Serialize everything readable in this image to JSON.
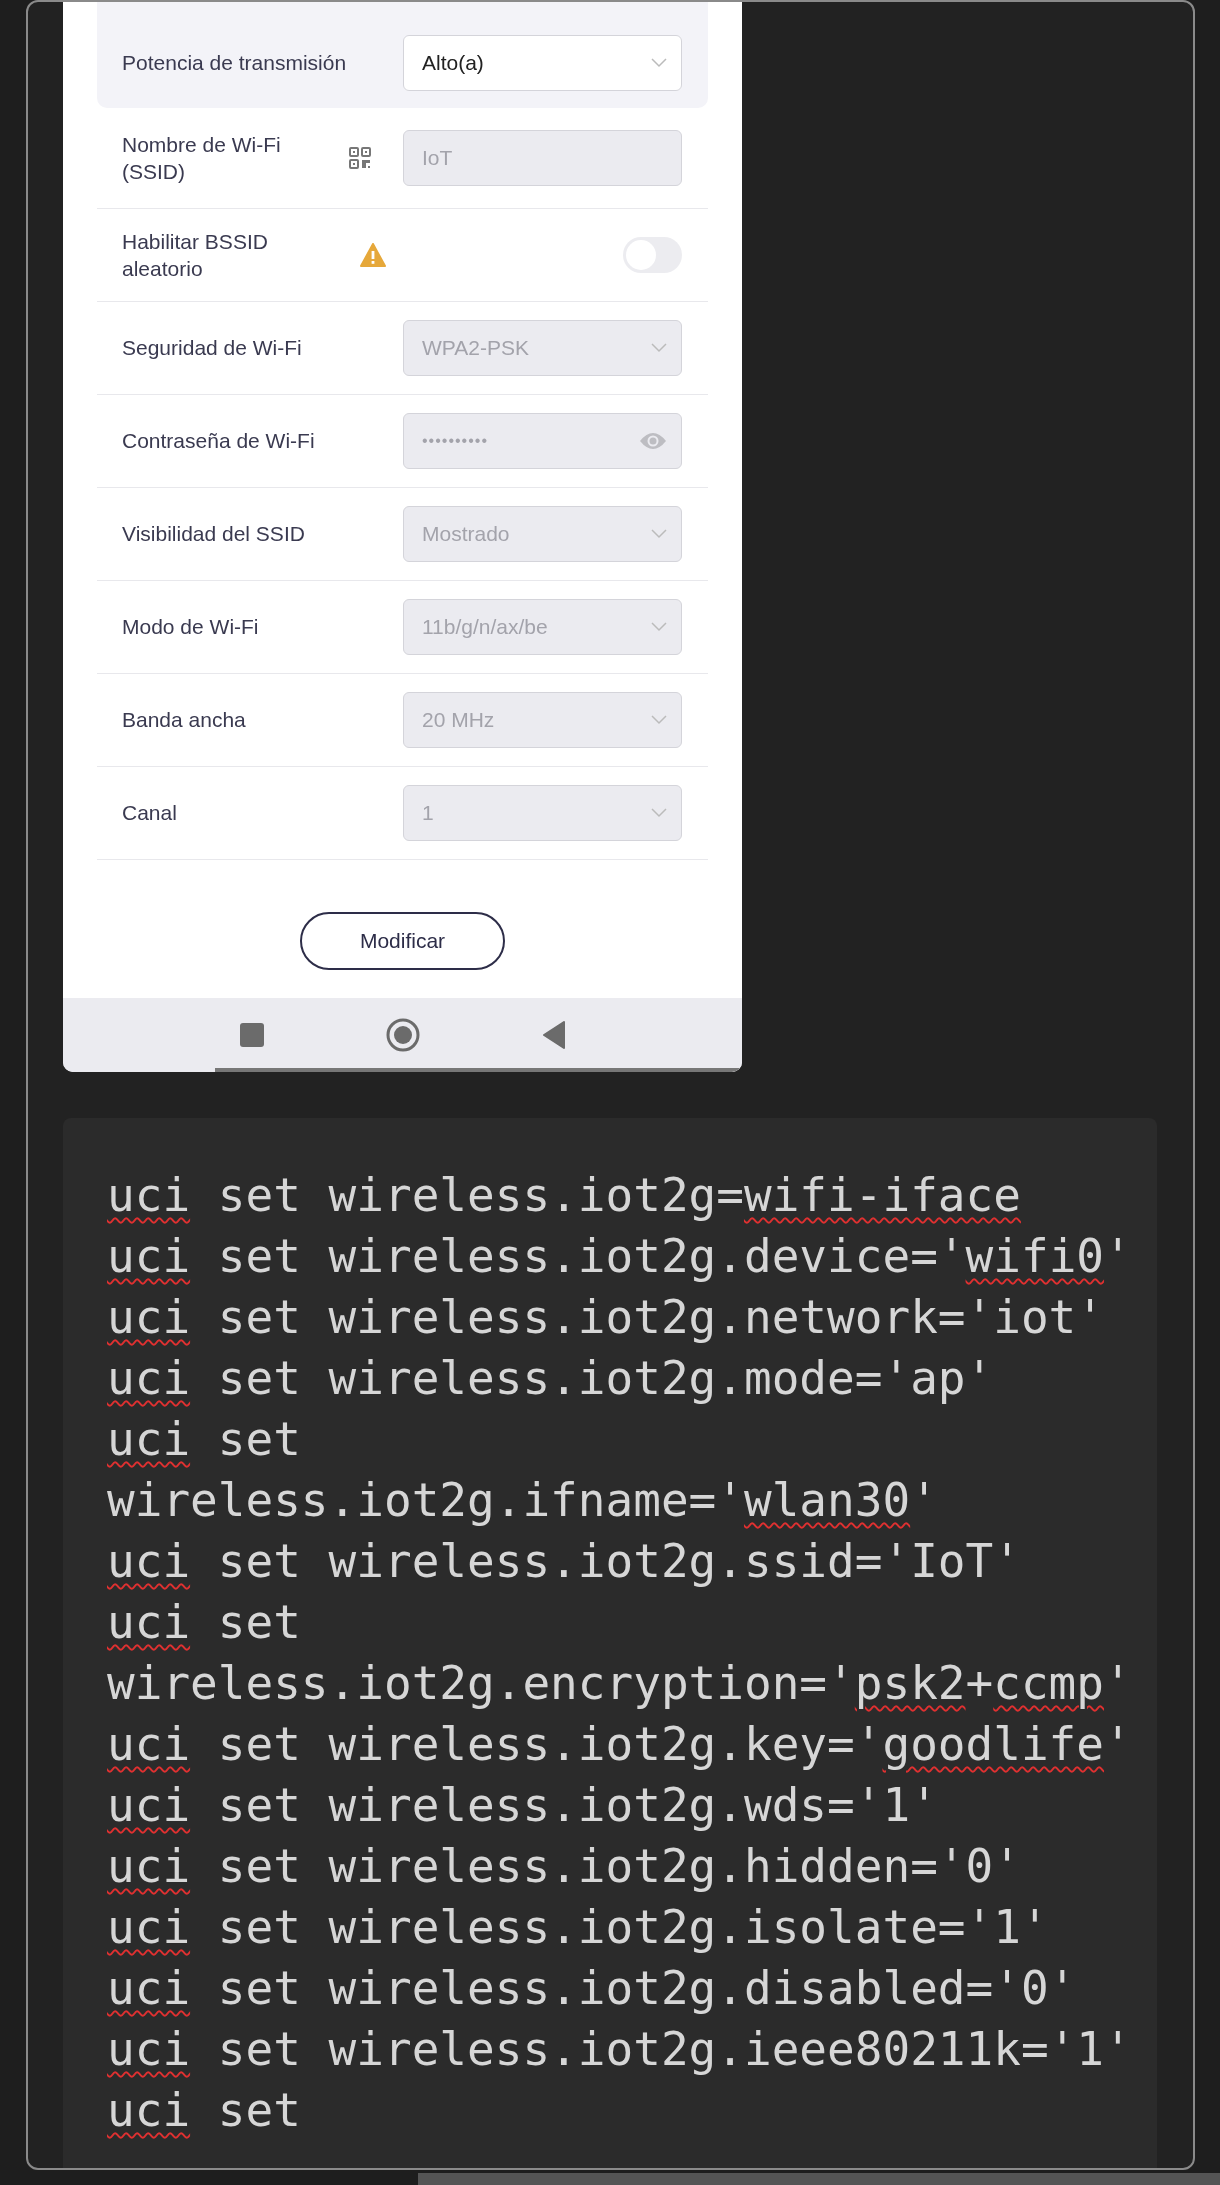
{
  "form": {
    "rows": [
      {
        "kind": "select",
        "label": "Potencia de transmisión",
        "value": "Alto(a)",
        "disabled": false,
        "highlighted": true
      },
      {
        "kind": "ssid",
        "label": "Nombre de Wi-Fi (SSID)",
        "value": "IoT",
        "disabled": true,
        "highlighted": false
      },
      {
        "kind": "toggle",
        "label": "Habilitar BSSID aleatorio",
        "on": false,
        "highlighted": false
      },
      {
        "kind": "select",
        "label": "Seguridad de Wi-Fi",
        "value": "WPA2-PSK",
        "disabled": true,
        "highlighted": false
      },
      {
        "kind": "password",
        "label": "Contraseña de Wi-Fi",
        "value": "••••••••••",
        "disabled": true,
        "highlighted": false
      },
      {
        "kind": "select",
        "label": "Visibilidad del SSID",
        "value": "Mostrado",
        "disabled": true,
        "highlighted": false
      },
      {
        "kind": "select",
        "label": "Modo de Wi-Fi",
        "value": "11b/g/n/ax/be",
        "disabled": true,
        "highlighted": false
      },
      {
        "kind": "select",
        "label": "Banda ancha",
        "value": "20 MHz",
        "disabled": true,
        "highlighted": false
      },
      {
        "kind": "select",
        "label": "Canal",
        "value": "1",
        "disabled": true,
        "highlighted": false
      }
    ],
    "button": "Modificar"
  },
  "code": {
    "lines": [
      [
        {
          "text": "uci",
          "misspelled": true
        },
        {
          "text": " set wireless.iot2g=",
          "misspelled": false
        },
        {
          "text": "wifi-iface",
          "misspelled": true
        }
      ],
      [
        {
          "text": "uci",
          "misspelled": true
        },
        {
          "text": " set wireless.iot2g.device='",
          "misspelled": false
        },
        {
          "text": "wifi0",
          "misspelled": true
        },
        {
          "text": "'",
          "misspelled": false
        }
      ],
      [
        {
          "text": "uci",
          "misspelled": true
        },
        {
          "text": " set wireless.iot2g.network='iot'",
          "misspelled": false
        }
      ],
      [
        {
          "text": "uci",
          "misspelled": true
        },
        {
          "text": " set wireless.iot2g.mode='ap'",
          "misspelled": false
        }
      ],
      [
        {
          "text": "uci",
          "misspelled": true
        },
        {
          "text": " set",
          "misspelled": false
        }
      ],
      [
        {
          "text": "wireless.iot2g.ifname='",
          "misspelled": false
        },
        {
          "text": "wlan30",
          "misspelled": true
        },
        {
          "text": "'",
          "misspelled": false
        }
      ],
      [
        {
          "text": "uci",
          "misspelled": true
        },
        {
          "text": " set wireless.iot2g.ssid='IoT'",
          "misspelled": false
        }
      ],
      [
        {
          "text": "uci",
          "misspelled": true
        },
        {
          "text": " set",
          "misspelled": false
        }
      ],
      [
        {
          "text": "wireless.iot2g.encryption='",
          "misspelled": false
        },
        {
          "text": "psk2",
          "misspelled": true
        },
        {
          "text": "+",
          "misspelled": false
        },
        {
          "text": "ccmp",
          "misspelled": true
        },
        {
          "text": "'",
          "misspelled": false
        }
      ],
      [
        {
          "text": "uci",
          "misspelled": true
        },
        {
          "text": " set wireless.iot2g.key='",
          "misspelled": false
        },
        {
          "text": "goodlife",
          "misspelled": true
        },
        {
          "text": "'",
          "misspelled": false
        }
      ],
      [
        {
          "text": "uci",
          "misspelled": true
        },
        {
          "text": " set wireless.iot2g.wds='1'",
          "misspelled": false
        }
      ],
      [
        {
          "text": "uci",
          "misspelled": true
        },
        {
          "text": " set wireless.iot2g.hidden='0'",
          "misspelled": false
        }
      ],
      [
        {
          "text": "uci",
          "misspelled": true
        },
        {
          "text": " set wireless.iot2g.isolate='1'",
          "misspelled": false
        }
      ],
      [
        {
          "text": "uci",
          "misspelled": true
        },
        {
          "text": " set wireless.iot2g.disabled='0'",
          "misspelled": false
        }
      ],
      [
        {
          "text": "uci",
          "misspelled": true
        },
        {
          "text": " set wireless.iot2g.ieee80211k='1'",
          "misspelled": false
        }
      ],
      [
        {
          "text": "uci",
          "misspelled": true
        },
        {
          "text": " set",
          "misspelled": false
        }
      ]
    ]
  }
}
